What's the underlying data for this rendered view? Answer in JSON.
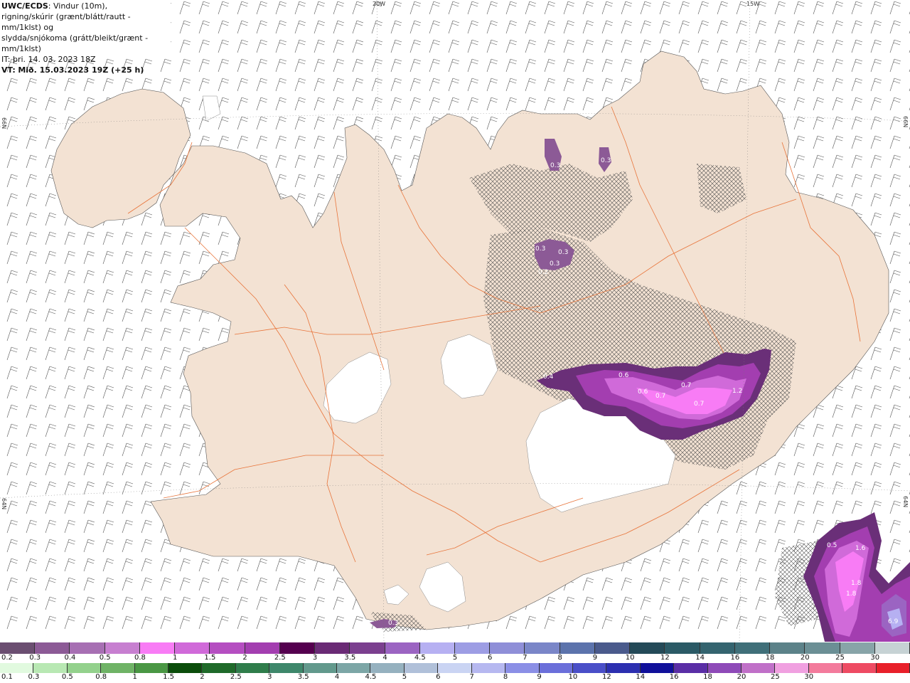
{
  "header": {
    "title": "UWC/ECDS",
    "title_suffix": ": Vindur (10m),",
    "line2": "rigning/skúrir (grænt/blátt/rautt - mm/1klst) og",
    "line3": "slydda/snjókoma (grátt/bleikt/grænt - mm/1klst)",
    "init_time": "IT: þri. 14. 03. 2023 18Z",
    "valid_label": "VT:",
    "valid_time": "Mið. 15.03.2023 19Z (+25 h)"
  },
  "grid_labels": {
    "lon_20w": "20W",
    "lon_15w": "15W",
    "lat_66n_left": "66N",
    "lat_66n_right": "66N",
    "lat_64n_left": "64N",
    "lat_64n_right": "64N"
  },
  "precip_values": [
    {
      "label": "0.3"
    },
    {
      "label": "0.3"
    },
    {
      "label": "0.3"
    },
    {
      "label": "0.3"
    },
    {
      "label": "0.3"
    },
    {
      "label": "0.2"
    },
    {
      "label": "0.4"
    },
    {
      "label": "0.6"
    },
    {
      "label": "0.6"
    },
    {
      "label": "0.7"
    },
    {
      "label": "0.7"
    },
    {
      "label": "0.7"
    },
    {
      "label": "1.2"
    },
    {
      "label": "0.5"
    },
    {
      "label": "1.6"
    },
    {
      "label": "1.8"
    },
    {
      "label": "1.8"
    },
    {
      "label": "6.9"
    },
    {
      "label": "0.3"
    }
  ],
  "colors": {
    "land": "#f3e2d3",
    "sea": "#ffffff",
    "roads": "#e8743a",
    "glacier": "#ffffff",
    "snow_light": "#b072c0",
    "snow_mid": "#cc55dd",
    "snow_strong": "#ee66ee",
    "snow_dark": "#6a2f78"
  },
  "legend_snow": {
    "labels": [
      "0.2",
      "0.3",
      "0.4",
      "0.5",
      "0.8",
      "1",
      "1.5",
      "2",
      "2.5",
      "3",
      "3.5",
      "4",
      "4.5",
      "5",
      "6",
      "7",
      "8",
      "9",
      "10",
      "12",
      "14",
      "16",
      "18",
      "20",
      "25",
      "30"
    ],
    "colors": [
      "#6b4e71",
      "#8c5a96",
      "#a76fb3",
      "#c77fd0",
      "#f87cf5",
      "#d06ad9",
      "#b54ec1",
      "#a33eb0",
      "#55004f",
      "#6a2a75",
      "#7b3f8f",
      "#9b64c2",
      "#b6b0f2",
      "#9d9de4",
      "#8f8fd8",
      "#7a86c8",
      "#5c73ac",
      "#4a5a8c",
      "#244a58",
      "#2b5a66",
      "#34646f",
      "#406f79",
      "#5c8289",
      "#6b8f95",
      "#88a4a8",
      "#c6d2d4"
    ]
  },
  "legend_rain": {
    "labels": [
      "0.1",
      "0.3",
      "0.5",
      "0.8",
      "1",
      "1.5",
      "2",
      "2.5",
      "3",
      "3.5",
      "4",
      "4.5",
      "5",
      "6",
      "7",
      "8",
      "9",
      "10",
      "12",
      "14",
      "16",
      "18",
      "20",
      "25",
      "30"
    ],
    "colors": [
      "#e1fadf",
      "#b8e8b3",
      "#93d18c",
      "#6fb366",
      "#4a9744",
      "#0b4d0b",
      "#1f6a2a",
      "#2f7d4b",
      "#3e876b",
      "#62998c",
      "#7ca6a6",
      "#95b1bf",
      "#b0c0d9",
      "#cad4f3",
      "#b6b8f0",
      "#8b8fe6",
      "#6b6fda",
      "#4a4fc8",
      "#2c2fb0",
      "#10109a",
      "#5a2ea6",
      "#8e4ab8",
      "#c070c8",
      "#f0a0e0",
      "#f37b9c",
      "#ee4b63",
      "#e8202a"
    ]
  }
}
